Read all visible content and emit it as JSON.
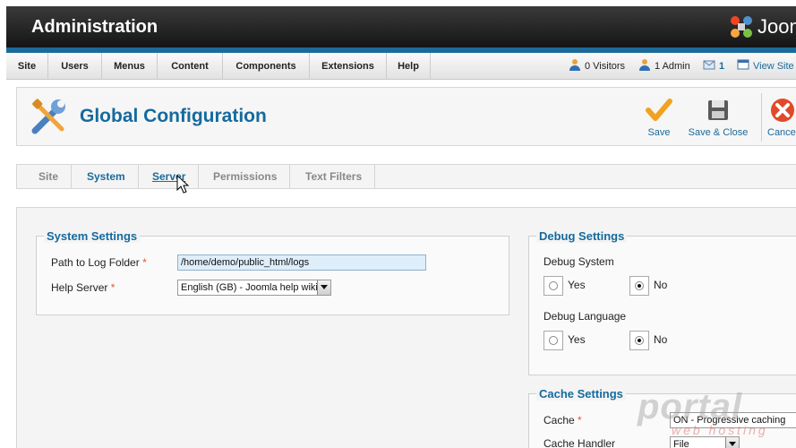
{
  "header": {
    "title": "Administration",
    "logo_text": "Jooml"
  },
  "menu": {
    "items": [
      "Site",
      "Users",
      "Menus",
      "Content",
      "Components",
      "Extensions",
      "Help"
    ]
  },
  "status": {
    "visitors": "0 Visitors",
    "admins": "1 Admin",
    "messages": "1",
    "view_site": "View Site"
  },
  "toolbar": {
    "title": "Global Configuration",
    "save": "Save",
    "save_close": "Save & Close",
    "cancel": "Cance"
  },
  "tabs": [
    "Site",
    "System",
    "Server",
    "Permissions",
    "Text Filters"
  ],
  "system_settings": {
    "legend": "System Settings",
    "log_path_label": "Path to Log Folder",
    "log_path_value": "/home/demo/public_html/logs",
    "help_server_label": "Help Server",
    "help_server_value": "English (GB) - Joomla help wiki",
    "required_mark": "*"
  },
  "debug_settings": {
    "legend": "Debug Settings",
    "debug_system_label": "Debug System",
    "debug_language_label": "Debug Language",
    "yes": "Yes",
    "no": "No",
    "debug_system_value": "No",
    "debug_language_value": "No"
  },
  "cache_settings": {
    "legend": "Cache Settings",
    "cache_label": "Cache",
    "cache_value": "ON - Progressive caching",
    "cache_handler_label": "Cache Handler",
    "cache_handler_value": "File"
  },
  "watermark": {
    "main": "portal",
    "sub": "web hosting"
  },
  "colors": {
    "accent": "#156a9e",
    "required": "#e05a2a",
    "header_dark": "#151515"
  }
}
